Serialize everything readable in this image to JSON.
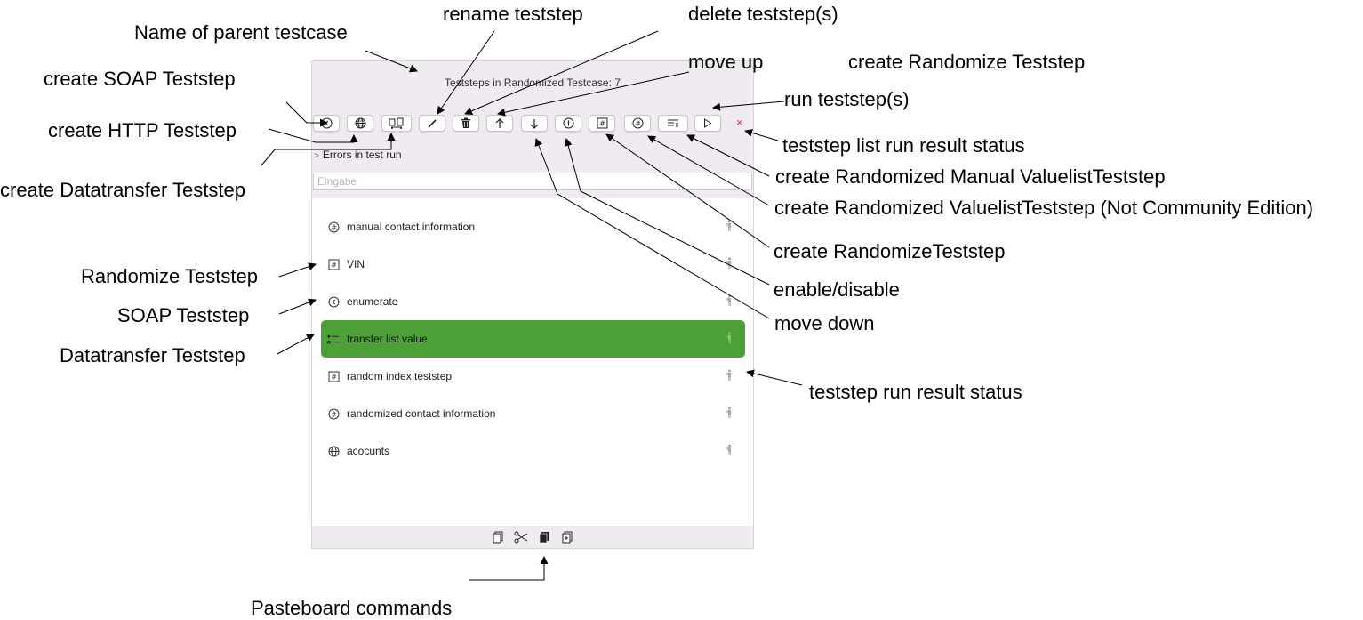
{
  "panel": {
    "title": "Teststeps in Randomized Testcase: 7",
    "errors_label": "Errors in test run",
    "search_placeholder": "Eingabe",
    "status_mark": "×"
  },
  "toolbar": [
    {
      "name": "create-soap-teststep-button",
      "icon": "soap-icon"
    },
    {
      "name": "create-http-teststep-button",
      "icon": "globe-icon"
    },
    {
      "name": "create-datatransfer-teststep-button",
      "icon": "transfer-icon"
    },
    {
      "name": "rename-teststep-button",
      "icon": "pencil-icon"
    },
    {
      "name": "delete-teststep-button",
      "icon": "trash-icon"
    },
    {
      "name": "move-up-button",
      "icon": "arrow-up-icon"
    },
    {
      "name": "move-down-button",
      "icon": "arrow-down-icon"
    },
    {
      "name": "enable-disable-button",
      "icon": "toggle-icon"
    },
    {
      "name": "create-randomize-teststep-button",
      "icon": "hash-square-icon"
    },
    {
      "name": "create-randomized-valuelist-teststep-button",
      "icon": "hash-circle-icon"
    },
    {
      "name": "create-randomized-manual-valuelist-teststep-button",
      "icon": "list-icon"
    },
    {
      "name": "run-teststep-button",
      "icon": "play-icon"
    }
  ],
  "teststeps": [
    {
      "label": "manual contact information",
      "icon": "hash-circle-icon",
      "selected": false
    },
    {
      "label": "VIN",
      "icon": "hash-square-icon",
      "selected": false
    },
    {
      "label": "enumerate",
      "icon": "soap-icon",
      "selected": false
    },
    {
      "label": "transfer list value",
      "icon": "transfer-list-icon",
      "selected": true
    },
    {
      "label": "random index teststep",
      "icon": "hash-square-icon",
      "selected": false
    },
    {
      "label": "randomized contact information",
      "icon": "hash-circle-icon",
      "selected": false
    },
    {
      "label": "acocunts",
      "icon": "globe-icon",
      "selected": false
    }
  ],
  "footer_icons": [
    "copy-icon",
    "cut-icon",
    "paste-icon",
    "duplicate-icon"
  ],
  "annotations": {
    "name_parent": "Name of parent testcase",
    "rename": "rename teststep",
    "delete": "delete teststep(s)",
    "move_up": "move up",
    "create_randomize_top": "create Randomize Teststep",
    "run": "run teststep(s)",
    "create_soap": "create SOAP Teststep",
    "create_http": "create HTTP Teststep",
    "create_datatransfer": "create Datatransfer Teststep",
    "list_status": "teststep list run result status",
    "create_manual_valuelist": "create Randomized Manual ValuelistTeststep",
    "create_valuelist": "create Randomized ValuelistTeststep (Not Community Edition)",
    "create_randomize": "create RandomizeTeststep",
    "enable_disable": "enable/disable",
    "move_down": "move down",
    "randomize_teststep": "Randomize Teststep",
    "soap_teststep": "SOAP Teststep",
    "datatransfer_teststep": "Datatransfer Teststep",
    "step_status": "teststep run result status",
    "pasteboard": "Pasteboard commands"
  }
}
